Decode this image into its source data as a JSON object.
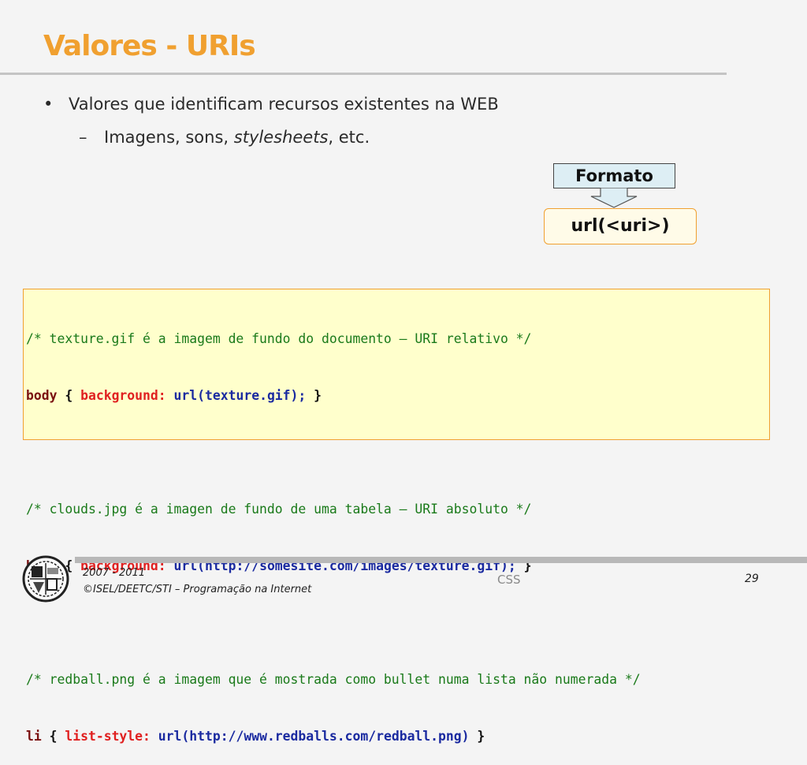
{
  "slide": {
    "title": "Valores - URIs",
    "bullets": {
      "level1": "Valores que identificam recursos existentes na WEB",
      "level2_prefix": "Imagens, sons, ",
      "level2_italic": "stylesheets",
      "level2_suffix": ", etc."
    },
    "format": {
      "label": "Formato",
      "value": "url(<uri>)"
    },
    "code": [
      {
        "comment": "/* texture.gif é a imagem de fundo do documento – URI relativo */"
      },
      {
        "selector": "body",
        "open": " { ",
        "property": "background:",
        "value": " url(texture.gif);",
        "close": " }"
      },
      {
        "blank": ""
      },
      {
        "comment": "/* clouds.jpg é a imagen de fundo de uma tabela – URI absoluto */"
      },
      {
        "selector": "body",
        "open": " { ",
        "property": "background:",
        "value": " url(http://somesite.com/images/texture.gif);",
        "close": " }"
      },
      {
        "blank": ""
      },
      {
        "comment": "/* redball.png é a imagem que é mostrada como bullet numa lista não numerada */"
      },
      {
        "selector": "li",
        "open": " { ",
        "property": "list-style:",
        "value": " url(http://www.redballs.com/redball.png)",
        "close": " }"
      }
    ]
  },
  "footer": {
    "years": "2007 - 2011",
    "credits": "©ISEL/DEETC/STI – Programação na Internet",
    "topic": "CSS",
    "page": "29"
  },
  "icons": {
    "bullet": "•",
    "dash": "–",
    "logo": "isel-logo-icon",
    "arrow": "down-arrow-icon"
  },
  "colors": {
    "title": "#f0a030",
    "comment": "#1a7a1a",
    "selector": "#7a1010",
    "property": "#e02020",
    "value": "#1a2aa0"
  }
}
